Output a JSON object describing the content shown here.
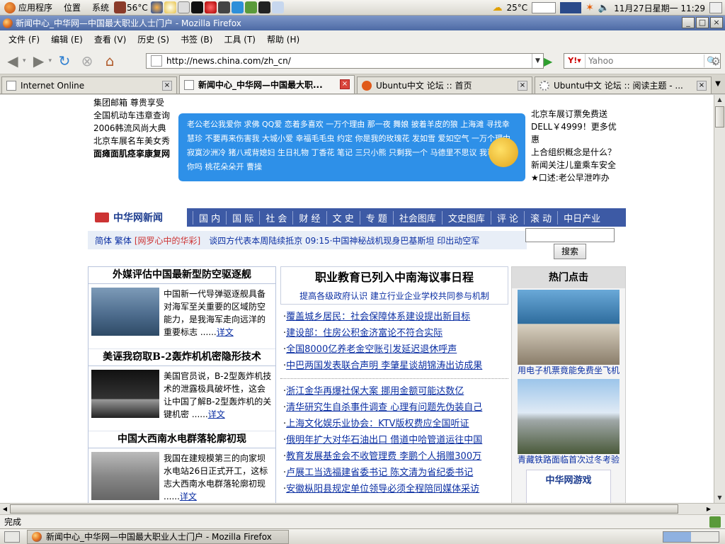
{
  "panel": {
    "menus": [
      "应用程序",
      "位置",
      "系统"
    ],
    "temp_cpu": "56°C",
    "weather": "25°C",
    "clock": "11月27日星期一 11:29"
  },
  "window": {
    "title": "新闻中心_中华网—中国最大职业人士门户 - Mozilla Firefox",
    "buttons": [
      "_",
      "□",
      "×"
    ]
  },
  "menubar": [
    "文件 (F)",
    "编辑 (E)",
    "查看 (V)",
    "历史 (S)",
    "书签 (B)",
    "工具 (T)",
    "帮助 (H)"
  ],
  "nav": {
    "url": "http://news.china.com/zh_cn/",
    "search_placeholder": "Yahoo"
  },
  "tabs": [
    {
      "label": "Internet Online",
      "active": false
    },
    {
      "label": "新闻中心_中华网—中国最大职...",
      "active": true
    },
    {
      "label": "Ubuntu中文 论坛 :: 首页",
      "active": false
    },
    {
      "label": "Ubuntu中文 论坛 :: 阅读主题 - ...",
      "active": false
    }
  ],
  "page": {
    "top_left": [
      "集团邮箱 尊贵享受",
      "全国机动车违章查询",
      "2006韩流风尚大典",
      "北京车展名车美女秀",
      "面瘫面肌痉挛康复网"
    ],
    "ad_text": "老公老公我爱你 求佛 QQ爱 恋着多喜欢 一万个理由 那一夜 舞娘 披着羊皮的狼 上海滩 寻找幸慧珍 不要再来伤害我 大城小爱 幸福毛毛虫 约定 你是我的玫瑰花 发如雪 爱如空气 一万个理由 寂寞沙洲冷 猪八戒背媳妇 生日礼物 丁香花 笔记 三只小熊 只剩我一个 马德里不思议 我可以抱你吗 桃花朵朵开 曹操",
    "top_right": [
      "北京车展订票免费送",
      "DELL￥4999！更多优惠",
      "上合组织概念是什么？",
      "新闻关注儿童乘车安全",
      "★口述:老公早泄咋办"
    ],
    "logo": "中华网新闻",
    "nav_items": [
      "国 内",
      "国 际",
      "社 会",
      "财 经",
      "文 史",
      "专 题",
      "社会图库",
      "文史图库",
      "评 论",
      "滚 动",
      "中日产业"
    ],
    "sub_prefix": "简体 繁体",
    "sub_bracket": "[网罗心中的华彩]",
    "ticker": "谈四方代表本周陆续抵京 09:15·中国神秘战机现身巴基斯坦 印出动空军",
    "search_btn": "搜索",
    "left_heads": [
      "外媒评估中国最新型防空驱逐舰",
      "美诬我窃取B-2轰炸机机密隐形技术",
      "中国大西南水电群落轮廓初现"
    ],
    "left_items": [
      {
        "text": "中国新一代导弹驱逐舰具备对海军至关重要的区域防空能力，是我海军走向远洋的重要标志 ......",
        "more": "详文"
      },
      {
        "text": "美国官员说，B-2型轰炸机技术的泄露极具破坏性，这会让中国了解B-2型轰炸机的关键机密 ......",
        "more": "详文"
      },
      {
        "text": "我国在建规模第三的向家坝水电站26日正式开工，这标志大西南水电群落轮廓初现 ......",
        "more": "详文"
      }
    ],
    "mid_head": "职业教育已列入中南海议事日程",
    "mid_sub": "提高各级政府认识 建立行业企业学校共同参与机制",
    "mid_links": [
      "覆盖城乡居民：社会保障体系建设提出新目标",
      "建设部：住房公积金济富论不符合实际",
      "全国8000亿养老金空账引发延迟退休呼声",
      "中巴两国发表联合声明 李肇星谈胡锦涛出访成果"
    ],
    "mid_links2": [
      "浙江金华再爆社保大案 挪用金额可能达数亿",
      "清华研究生自杀事件调查 心理有问题先伪装自己",
      "上海文化娱乐业协会：KTV版权费应全国听证",
      "俄明年扩大对华石油出口 借道中哈管道运往中国",
      "教育发展基金会不收管理费 李鹏个人捐赠300万",
      "卢展工当选福建省委书记 陈文清为省纪委书记",
      "安徽枞阳县规定单位领导必须全程陪同媒体采访"
    ],
    "right_head": "热门点击",
    "right_caps": [
      "用电子机票竟能免费坐飞机",
      "青藏铁路面临首次过冬考验"
    ],
    "game": "中华网游戏"
  },
  "status": "完成",
  "taskbar": {
    "item": "新闻中心_中华网—中国最大职业人士门户 - Mozilla Firefox"
  }
}
